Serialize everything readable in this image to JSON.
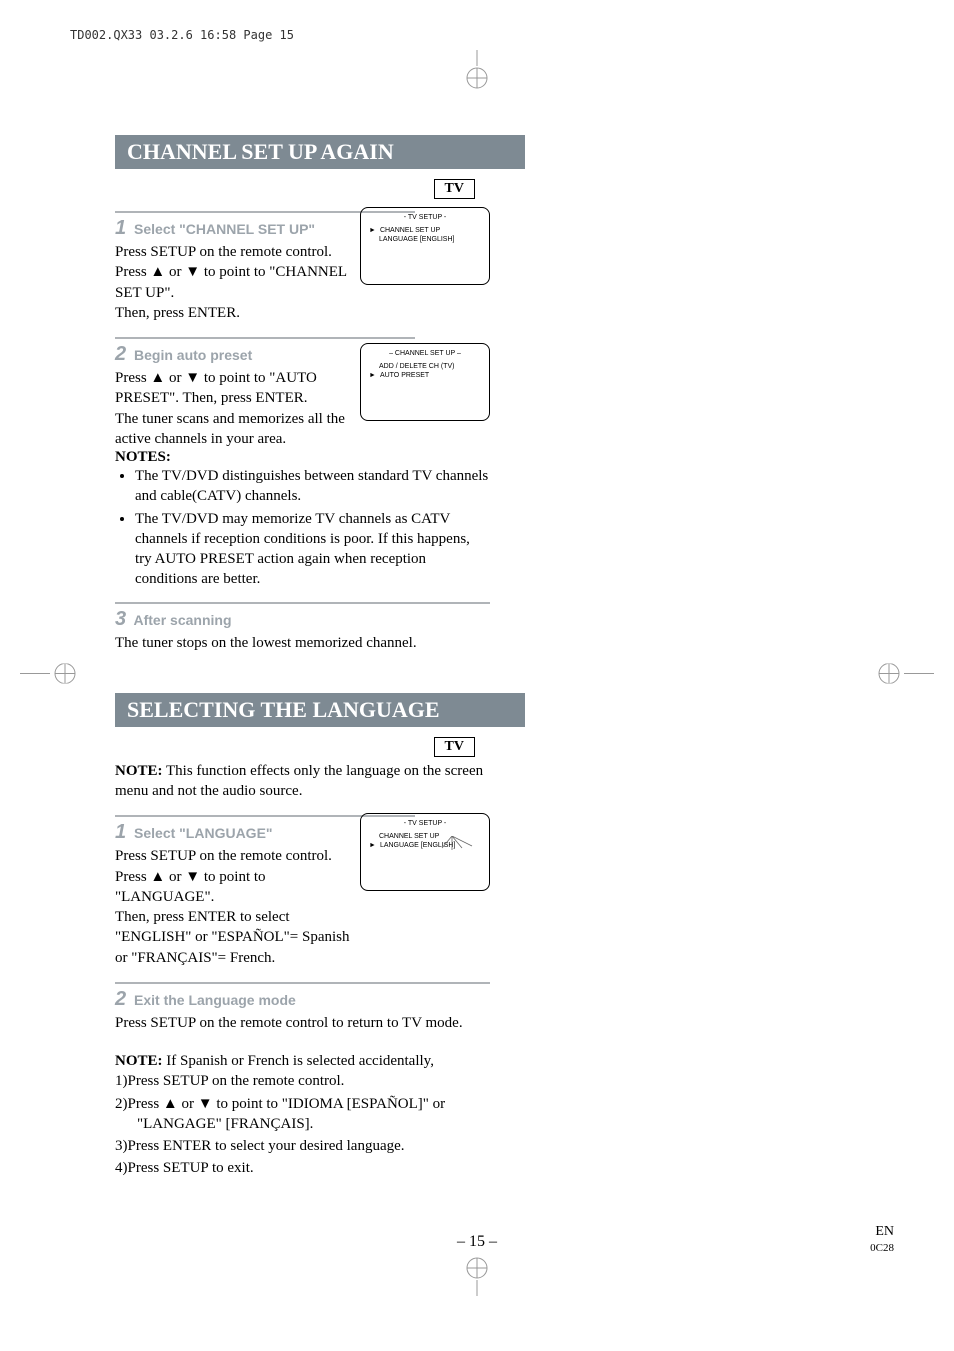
{
  "header": {
    "file_info": "TD002.QX33  03.2.6  16:58  Page 15"
  },
  "section1": {
    "title": "CHANNEL SET UP AGAIN",
    "badge": "TV",
    "step1": {
      "num": "1",
      "title": "Select \"CHANNEL SET UP\"",
      "body": "Press SETUP on the remote control.\nPress ▲ or ▼ to point to \"CHANNEL SET UP\".\nThen, press ENTER."
    },
    "step2": {
      "num": "2",
      "title": "Begin auto preset",
      "body": "Press ▲ or ▼ to point to \"AUTO PRESET\". Then, press ENTER.\nThe tuner scans and memorizes all the active channels in your area.",
      "notes_title": "NOTES:",
      "notes": [
        "The TV/DVD distinguishes between standard TV channels and cable(CATV) channels.",
        "The TV/DVD may memorize TV channels as CATV channels if reception conditions is poor. If this happens, try AUTO PRESET action again when reception conditions are better."
      ]
    },
    "step3": {
      "num": "3",
      "title": "After scanning",
      "body": "The tuner stops on the lowest memorized channel."
    }
  },
  "osd1": {
    "title": "- TV SETUP -",
    "line1": "CHANNEL SET UP",
    "line2": "LANGUAGE  [ENGLISH]"
  },
  "osd2": {
    "title": "– CHANNEL SET UP –",
    "line1": "ADD / DELETE CH (TV)",
    "line2": "AUTO PRESET"
  },
  "section2": {
    "title": "SELECTING THE LANGUAGE",
    "badge": "TV",
    "pre_note_label": "NOTE:",
    "pre_note": " This function effects only the language on the screen menu and not the audio source.",
    "step1": {
      "num": "1",
      "title": "Select \"LANGUAGE\"",
      "body": "Press SETUP on the remote control.\nPress ▲ or ▼ to point to \"LANGUAGE\".\nThen, press ENTER to select \"ENGLISH\" or \"ESPAÑOL\"= Spanish or \"FRANÇAIS\"= French."
    },
    "step2": {
      "num": "2",
      "title": "Exit the Language mode",
      "body": "Press SETUP on the remote control to return to TV mode."
    },
    "post_note_label": "NOTE:",
    "post_note": " If Spanish or French is selected accidentally,",
    "post_list": [
      "1)Press SETUP on the remote control.",
      "2)Press ▲ or ▼ to point to \"IDIOMA [ESPAÑOL]\" or \"LANGAGE\" [FRANÇAIS].",
      "3)Press ENTER to select your desired language.",
      "4)Press SETUP to exit."
    ]
  },
  "osd3": {
    "title": "- TV SETUP -",
    "line1": "CHANNEL SET UP",
    "line2": "LANGUAGE   [ENGLISH]"
  },
  "footer": {
    "page": "– 15 –",
    "code1": "EN",
    "code2": "0C28"
  }
}
